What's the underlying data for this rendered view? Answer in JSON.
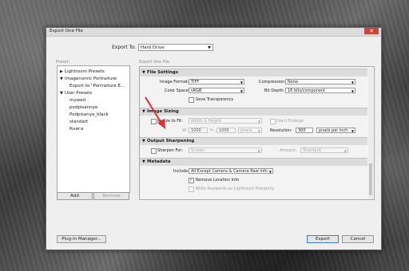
{
  "dialog": {
    "title": "Export One File",
    "close_symbol": "✕"
  },
  "export_to": {
    "label": "Export To:",
    "value": "Hard Drive"
  },
  "presets": {
    "header": "Preset:",
    "items": [
      {
        "label": "Lightroom Presets",
        "expanded": false
      },
      {
        "label": "Imagenomic Portraiture",
        "expanded": true
      },
      {
        "label": "Export to \"Portraiture E...",
        "expanded": null
      },
      {
        "label": "User Presets",
        "expanded": true
      },
      {
        "label": "mywed",
        "expanded": null
      },
      {
        "label": "podpisannye",
        "expanded": null
      },
      {
        "label": "Podpisanye_black",
        "expanded": null
      },
      {
        "label": "standart",
        "expanded": null
      },
      {
        "label": "Книга",
        "expanded": null
      }
    ],
    "add_label": "Add",
    "remove_label": "Remove"
  },
  "panel_header": "Export One File",
  "file_settings": {
    "title": "File Settings",
    "image_format_label": "Image Format:",
    "image_format_value": "TIFF",
    "compression_label": "Compression:",
    "compression_value": "None",
    "color_space_label": "Color Space:",
    "color_space_value": "sRGB",
    "bit_depth_label": "Bit Depth:",
    "bit_depth_value": "16 bits/component",
    "save_transparency_label": "Save Transparency"
  },
  "image_sizing": {
    "title": "Image Sizing",
    "resize_label": "Resize to Fit:",
    "resize_value": "Width & Height",
    "dont_enlarge_label": "Don't Enlarge",
    "w_label": "W:",
    "w_value": "1000",
    "h_label": "H:",
    "h_value": "1000",
    "unit_value": "pixels",
    "resolution_label": "Resolution:",
    "resolution_value": "300",
    "resolution_unit": "pixels per inch"
  },
  "output_sharpening": {
    "title": "Output Sharpening",
    "sharpen_for_label": "Sharpen For:",
    "sharpen_for_value": "Screen",
    "amount_label": "Amount:",
    "amount_value": "Standard"
  },
  "metadata": {
    "title": "Metadata",
    "include_label": "Include:",
    "include_value": "All Except Camera & Camera Raw Info",
    "remove_location_label": "Remove Location Info",
    "write_keywords_label": "Write Keywords as Lightroom Hierarchy"
  },
  "buttons": {
    "plugin_manager": "Plug-in Manager...",
    "export": "Export",
    "cancel": "Cancel"
  },
  "colors": {
    "accent_arrow": "#e0322b"
  }
}
